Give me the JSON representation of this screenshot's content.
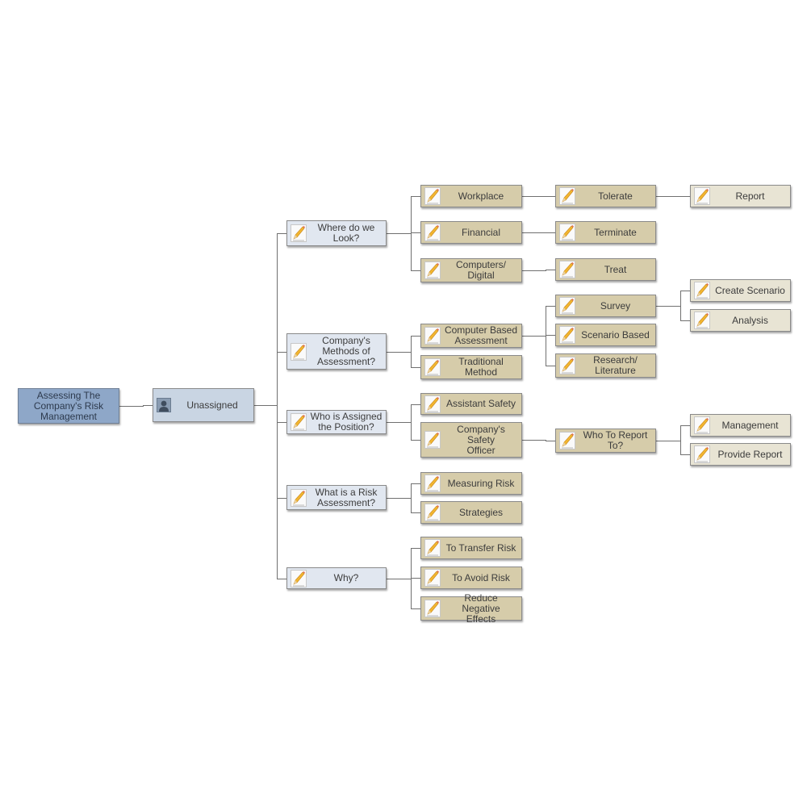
{
  "diagram": {
    "type": "mind-map",
    "root": {
      "id": "root",
      "label": "Assessing The Company's Risk Management",
      "children": [
        "unassigned"
      ]
    },
    "nodes": [
      {
        "id": "root",
        "label": "Assessing The\nCompany's Risk\nManagement",
        "level": 0,
        "icon": "none"
      },
      {
        "id": "unassigned",
        "label": "Unassigned",
        "level": 1,
        "icon": "person-icon",
        "parent": "root"
      },
      {
        "id": "where",
        "label": "Where do we\nLook?",
        "level": 2,
        "icon": "pencil-note-icon",
        "parent": "unassigned"
      },
      {
        "id": "methods",
        "label": "Company's\nMethods of\nAssessment?",
        "level": 2,
        "icon": "pencil-note-icon",
        "parent": "unassigned"
      },
      {
        "id": "who",
        "label": "Who is Assigned\nthe Position?",
        "level": 2,
        "icon": "pencil-note-icon",
        "parent": "unassigned"
      },
      {
        "id": "what",
        "label": "What is a Risk\nAssessment?",
        "level": 2,
        "icon": "pencil-note-icon",
        "parent": "unassigned"
      },
      {
        "id": "why",
        "label": "Why?",
        "level": 2,
        "icon": "pencil-note-icon",
        "parent": "unassigned"
      },
      {
        "id": "workplace",
        "label": "Workplace",
        "level": 3,
        "icon": "pencil-note-icon",
        "parent": "where"
      },
      {
        "id": "financial",
        "label": "Financial",
        "level": 3,
        "icon": "pencil-note-icon",
        "parent": "where"
      },
      {
        "id": "computers",
        "label": "Computers/\nDigital",
        "level": 3,
        "icon": "pencil-note-icon",
        "parent": "where"
      },
      {
        "id": "cba",
        "label": "Computer Based\nAssessment",
        "level": 3,
        "icon": "pencil-note-icon",
        "parent": "methods"
      },
      {
        "id": "traditional",
        "label": "Traditional\nMethod",
        "level": 3,
        "icon": "pencil-note-icon",
        "parent": "methods"
      },
      {
        "id": "assistant",
        "label": "Assistant Safety",
        "level": 3,
        "icon": "pencil-note-icon",
        "parent": "who"
      },
      {
        "id": "officer",
        "label": "Company's\nSafety\nOfficer",
        "level": 3,
        "icon": "pencil-note-icon",
        "parent": "who"
      },
      {
        "id": "measuring",
        "label": "Measuring Risk",
        "level": 3,
        "icon": "pencil-note-icon",
        "parent": "what"
      },
      {
        "id": "strategies",
        "label": "Strategies",
        "level": 3,
        "icon": "pencil-note-icon",
        "parent": "what"
      },
      {
        "id": "transfer",
        "label": "To Transfer Risk",
        "level": 3,
        "icon": "pencil-note-icon",
        "parent": "why"
      },
      {
        "id": "avoid",
        "label": "To Avoid Risk",
        "level": 3,
        "icon": "pencil-note-icon",
        "parent": "why"
      },
      {
        "id": "reduce",
        "label": "Reduce Negative\nEffects",
        "level": 3,
        "icon": "pencil-note-icon",
        "parent": "why"
      },
      {
        "id": "tolerate",
        "label": "Tolerate",
        "level": 4,
        "icon": "pencil-note-icon",
        "parent": "workplace"
      },
      {
        "id": "terminate",
        "label": "Terminate",
        "level": 4,
        "icon": "pencil-note-icon",
        "parent": "financial"
      },
      {
        "id": "treat",
        "label": "Treat",
        "level": 4,
        "icon": "pencil-note-icon",
        "parent": "computers"
      },
      {
        "id": "survey",
        "label": "Survey",
        "level": 4,
        "icon": "pencil-note-icon",
        "parent": "cba"
      },
      {
        "id": "scenario",
        "label": "Scenario Based",
        "level": 4,
        "icon": "pencil-note-icon",
        "parent": "cba"
      },
      {
        "id": "research",
        "label": "Research/\nLiterature",
        "level": 4,
        "icon": "pencil-note-icon",
        "parent": "cba"
      },
      {
        "id": "whoreport",
        "label": "Who To Report\nTo?",
        "level": 4,
        "icon": "pencil-note-icon",
        "parent": "officer"
      },
      {
        "id": "report",
        "label": "Report",
        "level": 5,
        "icon": "pencil-note-icon",
        "parent": "tolerate"
      },
      {
        "id": "create",
        "label": "Create Scenario",
        "level": 5,
        "icon": "pencil-note-icon",
        "parent": "survey"
      },
      {
        "id": "analysis",
        "label": "Analysis",
        "level": 5,
        "icon": "pencil-note-icon",
        "parent": "survey"
      },
      {
        "id": "management",
        "label": "Management",
        "level": 5,
        "icon": "pencil-note-icon",
        "parent": "whoreport"
      },
      {
        "id": "provide",
        "label": "Provide Report",
        "level": 5,
        "icon": "pencil-note-icon",
        "parent": "whoreport"
      }
    ],
    "colors": {
      "root_fill": "#8ea7c8",
      "level1_fill": "#c9d5e3",
      "level2_fill": "#e1e7f0",
      "level3_fill": "#d6ccaa",
      "level5_fill": "#e8e4d4",
      "connector": "#707070",
      "border": "#8a8a8a"
    }
  }
}
